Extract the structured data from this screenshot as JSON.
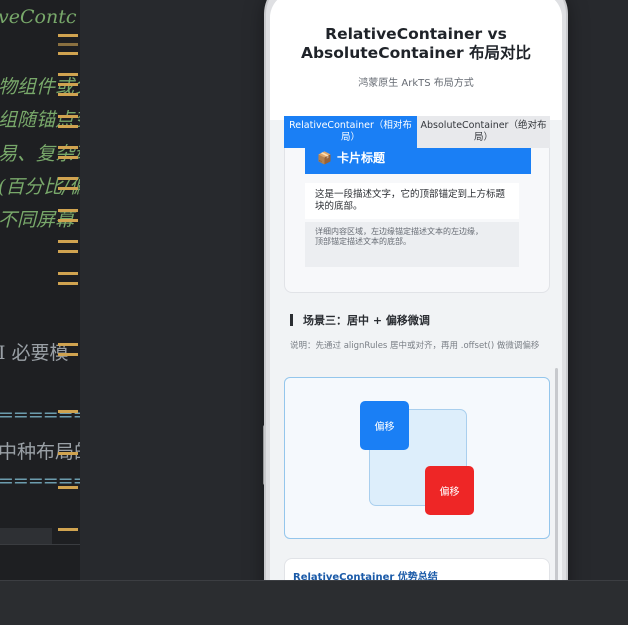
{
  "editor": {
    "lines": [
      "veContc",
      "物组件或父",
      "组随锚点变",
      "易、复杂动",
      "(百分比/偏",
      "不同屏幕",
      "I  必要模",
      "==========",
      "中种布局的对",
      "=========="
    ]
  },
  "app": {
    "title": "RelativeContainer vs AbsoluteContainer 布局对比",
    "subtitle": "鸿蒙原生 ArkTS 布局方式",
    "tabs": [
      {
        "label": "RelativeContainer（相对布局）",
        "active": true
      },
      {
        "label": "AbsoluteContainer（绝对布局）",
        "active": false
      }
    ]
  },
  "card1": {
    "icon": "package-icon",
    "emoji": "📦",
    "header": "卡片标题",
    "description": "这是一段描述文字，它的顶部锚定到上方标题块的底部。",
    "detail_line1": "详细内容区域，左边缘锚定描述文本的左边缘，",
    "detail_line2": "顶部锚定描述文本的底部。"
  },
  "scene3": {
    "title": "场景三：居中 + 偏移微调",
    "description": "说明：先通过 alignRules 居中或对齐，再用 .offset() 做微调偏移",
    "tag_blue": "偏移",
    "tag_red": "偏移"
  },
  "next_card": {
    "title": "RelativeContainer 优势总结"
  },
  "colors": {
    "accent": "#1a7ff5",
    "red": "#ee2626"
  }
}
